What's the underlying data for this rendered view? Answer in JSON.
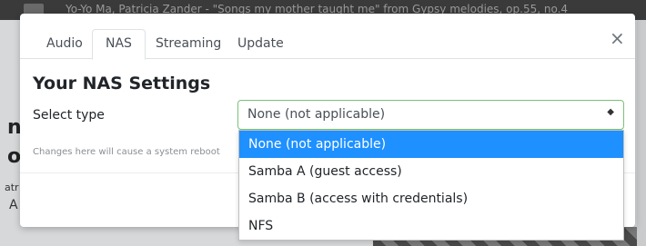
{
  "background": {
    "now_playing": "Yo-Yo Ma, Patricia Zander - \"Songs my mother taught me\" from Gypsy melodies, op.55, no.4",
    "fragments": [
      "n",
      "o",
      "atr",
      "A"
    ]
  },
  "modal": {
    "tabs": [
      {
        "label": "Audio",
        "active": false
      },
      {
        "label": "NAS",
        "active": true
      },
      {
        "label": "Streaming",
        "active": false
      },
      {
        "label": "Update",
        "active": false
      }
    ],
    "close_icon": "close-icon",
    "title": "Your NAS Settings",
    "select_label": "Select type",
    "select_value": "None (not applicable)",
    "hint": "Changes here will cause a system reboot",
    "options": [
      "None (not applicable)",
      "Samba A (guest access)",
      "Samba B (access with credentials)",
      "NFS"
    ],
    "selected_option_index": 0
  },
  "colors": {
    "highlight": "#1e90ff",
    "select_border": "#7ac27a"
  }
}
